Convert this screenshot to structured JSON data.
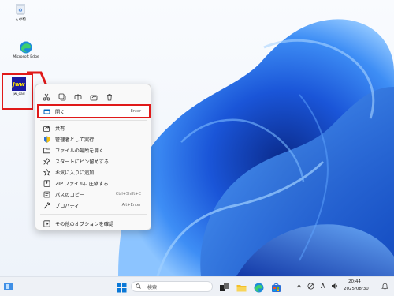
{
  "desktop": {
    "icons": [
      {
        "label": "ごみ箱"
      },
      {
        "label": "Microsoft Edge"
      },
      {
        "label": "jw_cad"
      }
    ]
  },
  "context_menu": {
    "quick_actions": [
      "cut-icon",
      "copy-icon",
      "rename-icon",
      "share-icon",
      "delete-icon"
    ],
    "items": [
      {
        "label": "開く",
        "shortcut": "Enter",
        "icon": "open-icon"
      },
      {
        "label": "共有",
        "shortcut": "",
        "icon": "share-icon"
      },
      {
        "label": "管理者として実行",
        "shortcut": "",
        "icon": "shield-icon"
      },
      {
        "label": "ファイルの場所を開く",
        "shortcut": "",
        "icon": "folder-icon"
      },
      {
        "label": "スタートにピン留めする",
        "shortcut": "",
        "icon": "pin-icon"
      },
      {
        "label": "お気に入りに追加",
        "shortcut": "",
        "icon": "star-icon"
      },
      {
        "label": "ZIP ファイルに圧縮する",
        "shortcut": "",
        "icon": "zip-icon"
      },
      {
        "label": "パスのコピー",
        "shortcut": "Ctrl+Shift+C",
        "icon": "copy-path-icon"
      },
      {
        "label": "プロパティ",
        "shortcut": "Alt+Enter",
        "icon": "wrench-icon"
      },
      {
        "label": "その他のオプションを確認",
        "shortcut": "",
        "icon": "more-options-icon"
      }
    ]
  },
  "taskbar": {
    "search_placeholder": "検索",
    "ime": "A",
    "time": "20:44",
    "date": "2025/08/30"
  },
  "colors": {
    "accent": "#0067c0",
    "highlight_border": "#e01919"
  }
}
